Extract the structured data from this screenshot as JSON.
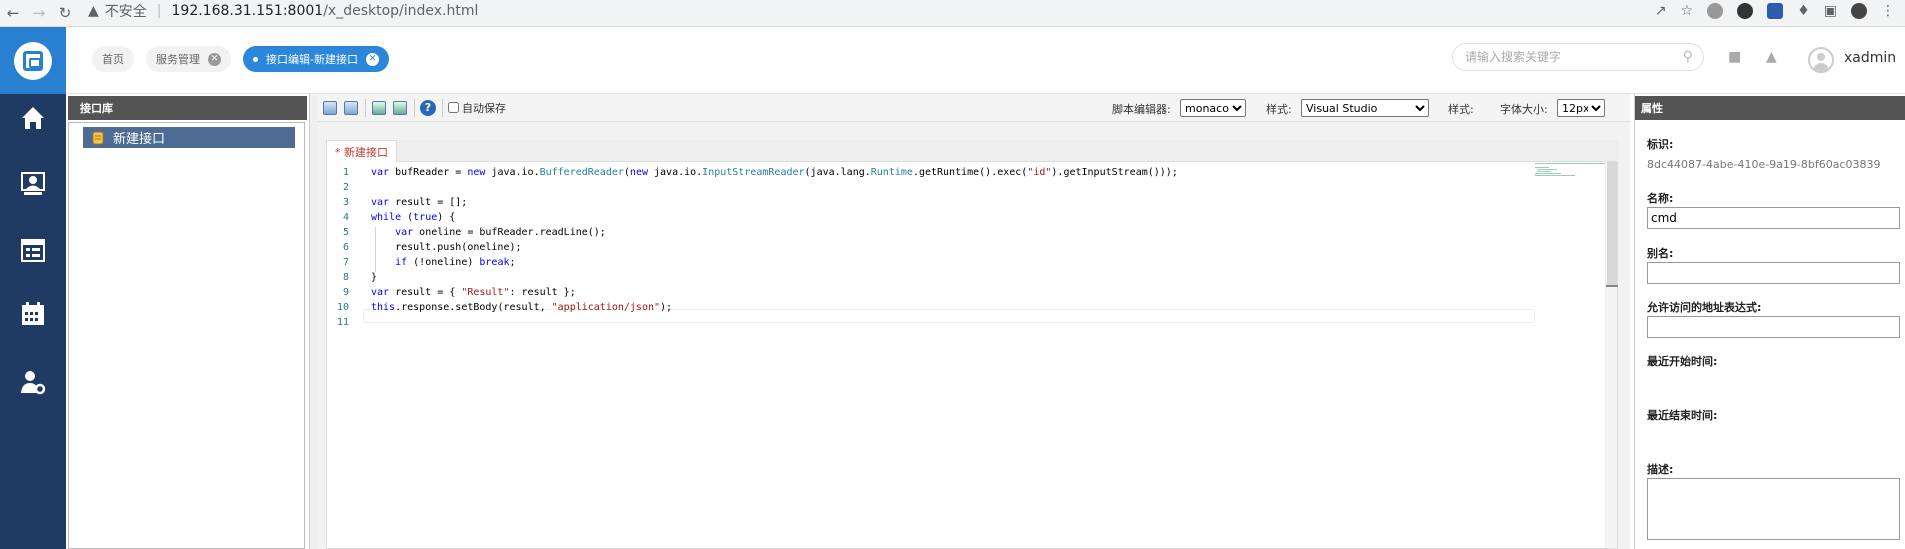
{
  "browser": {
    "not_secure": "不安全",
    "host": "192.168.31.151:8001",
    "path": "/x_desktop/index.html"
  },
  "header": {
    "tabs": [
      {
        "label": "首页"
      },
      {
        "label": "服务管理"
      },
      {
        "label": "接口编辑-新建接口"
      }
    ],
    "search_placeholder": "请输入搜索关键字",
    "username": "xadmin"
  },
  "sidebar": {
    "icons": [
      "home-icon",
      "user-board-icon",
      "calendar-list-icon",
      "calendar-icon",
      "user-settings-icon"
    ]
  },
  "library": {
    "title": "接口库",
    "items": [
      {
        "label": "新建接口"
      }
    ]
  },
  "toolbar": {
    "autosave_label": "自动保存",
    "script_editor_label": "脚本编辑器:",
    "script_editor_value": "monaco",
    "style_label": "样式:",
    "style_value": "Visual Studio",
    "style2_label": "样式:",
    "font_size_label": "字体大小:",
    "font_size_value": "12px"
  },
  "editor": {
    "file_tab": "* 新建接口",
    "line_numbers": [
      "1",
      "2",
      "3",
      "4",
      "5",
      "6",
      "7",
      "8",
      "9",
      "10",
      "11"
    ]
  },
  "properties": {
    "title": "属性",
    "id_label": "标识:",
    "id_value": "8dc44087-4abe-410e-9a19-8bf60ac03839",
    "name_label": "名称:",
    "name_value": "cmd",
    "alias_label": "别名:",
    "alias_value": "",
    "address_label": "允许访问的地址表达式:",
    "address_value": "",
    "last_start_label": "最近开始时间:",
    "last_end_label": "最近结束时间:",
    "desc_label": "描述:"
  }
}
